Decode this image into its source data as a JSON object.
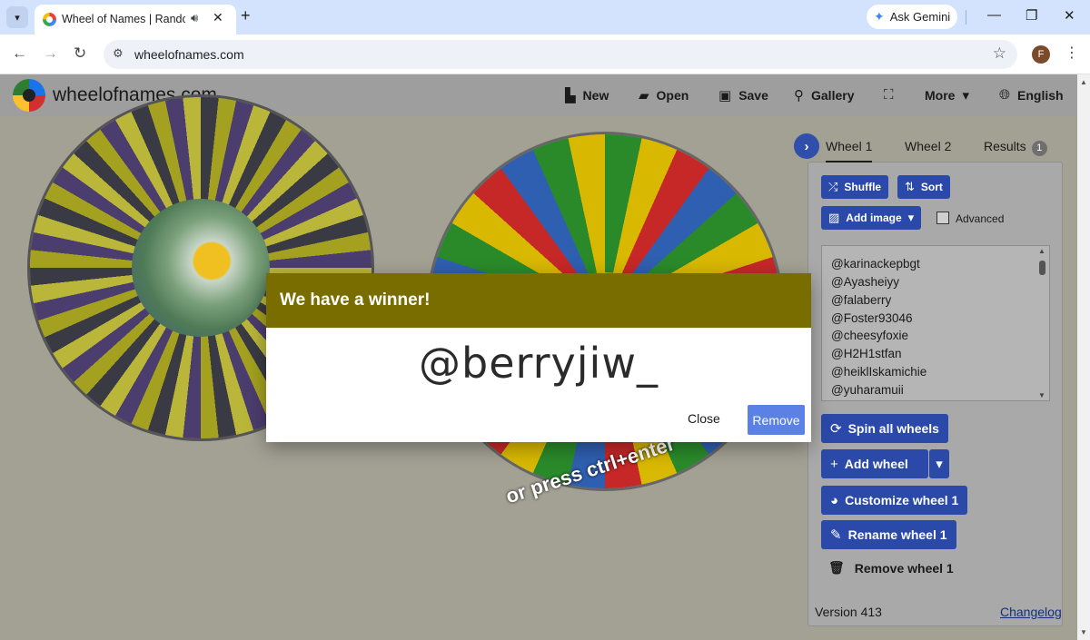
{
  "browser": {
    "tab_title": "Wheel of Names | Random",
    "address": "wheelofnames.com",
    "gemini_label": "Ask Gemini",
    "profile_initial": "F"
  },
  "header": {
    "brand": "wheelofnames.com",
    "new": "New",
    "open": "Open",
    "save": "Save",
    "gallery": "Gallery",
    "more": "More",
    "language": "English"
  },
  "wheel2": {
    "overlay_text": "or press ctrl+enter"
  },
  "panel": {
    "tabs": [
      "Wheel 1",
      "Wheel 2",
      "Results"
    ],
    "results_count": "1",
    "shuffle": "Shuffle",
    "sort": "Sort",
    "add_image": "Add image",
    "advanced": "Advanced",
    "names": [
      "@karinackepbgt",
      "@Ayasheiyy",
      "@falaberry",
      "@Foster93046",
      "@cheesyfoxie",
      "@H2H1stfan",
      "@heiklIskamichie",
      "@yuharamuii"
    ],
    "spin_all": "Spin all wheels",
    "add_wheel": "Add wheel",
    "customize": "Customize wheel 1",
    "rename": "Rename wheel 1",
    "remove_wheel": "Remove wheel 1",
    "version": "Version 413",
    "changelog": "Changelog"
  },
  "dialog": {
    "title": "We have a winner!",
    "winner": "@berryjiw_",
    "close": "Close",
    "remove": "Remove"
  }
}
